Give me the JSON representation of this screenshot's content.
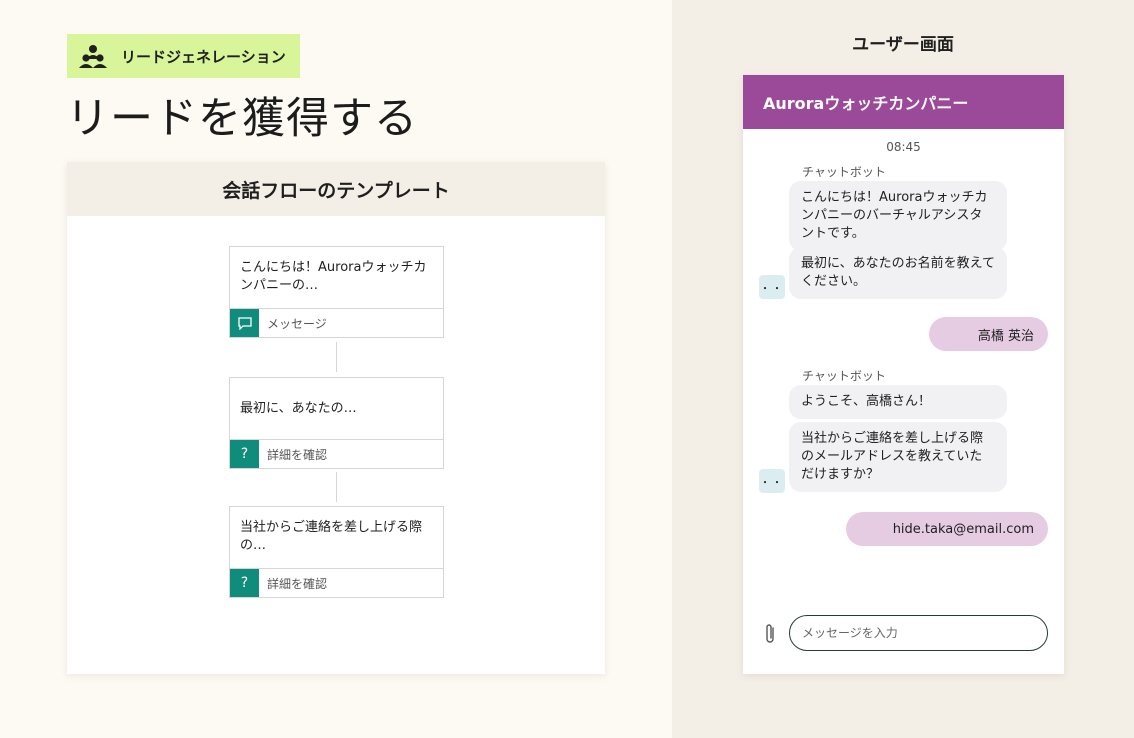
{
  "tag": {
    "label": "リードジェネレーション",
    "icon": "people-group-icon"
  },
  "main_title": "リードを獲得する",
  "template": {
    "title": "会話フローのテンプレート",
    "nodes": [
      {
        "text": "こんにちは！Auroraウォッチカンパニーの…",
        "foot_label": "メッセージ",
        "foot_icon": "speech-bubble-icon"
      },
      {
        "text": "最初に、あなたの…",
        "foot_label": "詳細を確認",
        "foot_icon": "question-icon"
      },
      {
        "text": "当社からご連絡を差し上げる際の…",
        "foot_label": "詳細を確認",
        "foot_icon": "question-icon"
      }
    ]
  },
  "right": {
    "title": "ユーザー画面",
    "chat": {
      "header_title": "Auroraウォッチカンパニー",
      "time": "08:45",
      "messages": [
        {
          "sender": "チャットボット",
          "texts": [
            "こんにちは！Auroraウォッチカンパニーのバーチャルアシスタントです。",
            "最初に、あなたのお名前を教えてください。"
          ]
        },
        {
          "user_text": "高橋 英治"
        },
        {
          "sender": "チャットボット",
          "texts": [
            "ようこそ、高橋さん！",
            "当社からご連絡を差し上げる際のメールアドレスを教えていただけますか？"
          ]
        },
        {
          "user_text": "hide.taka@email.com"
        }
      ],
      "input_placeholder": "メッセージを入力",
      "attach_icon": "paperclip-icon",
      "typing_indicator": "・・"
    }
  },
  "colors": {
    "page_bg": "#fdfaf3",
    "right_bg": "#f4efe6",
    "tag_bg": "#d8f59a",
    "accent_teal": "#0f8c7c",
    "chat_header": "#9b4a99",
    "user_bubble": "#e5cce3",
    "bot_bubble": "#f1f1f4"
  }
}
